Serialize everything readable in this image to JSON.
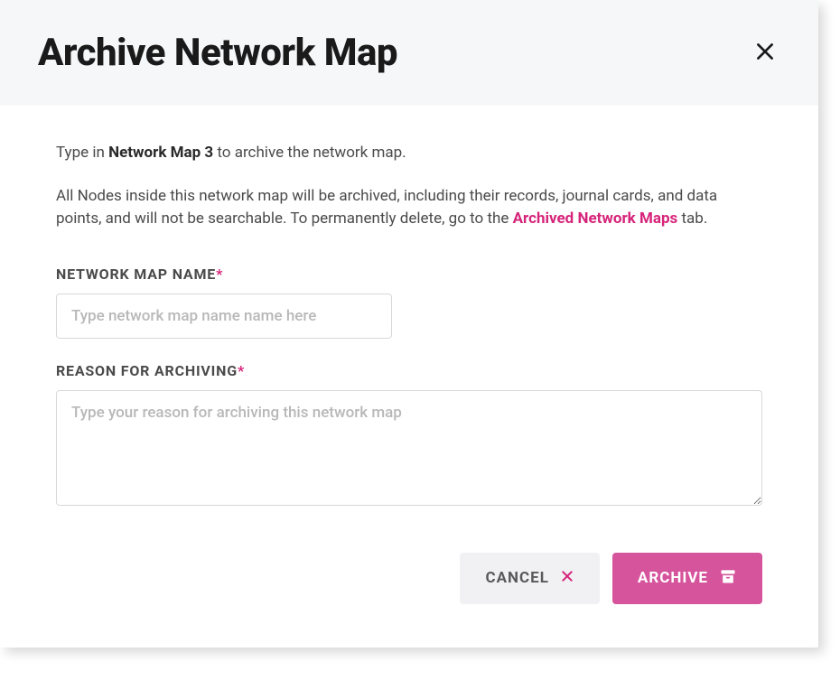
{
  "modal": {
    "title": "Archive Network Map",
    "instruction_prefix": "Type in ",
    "instruction_bold": "Network Map 3",
    "instruction_suffix": " to archive the network map.",
    "description_part1": "All Nodes inside this network map will be archived, including their records, journal cards, and data points, and will not be searchable. To permanently delete, go to the ",
    "description_link": "Archived Network Maps",
    "description_part2": " tab."
  },
  "form": {
    "name_label": "NETWORK MAP NAME",
    "name_placeholder": "Type network map name name here",
    "name_value": "",
    "reason_label": "REASON FOR ARCHIVING",
    "reason_placeholder": "Type your reason for archiving this network map",
    "reason_value": ""
  },
  "buttons": {
    "cancel": "CANCEL",
    "archive": "ARCHIVE"
  },
  "colors": {
    "accent": "#d6247a",
    "primary_button": "#d6549c",
    "header_bg": "#f6f7f9"
  }
}
